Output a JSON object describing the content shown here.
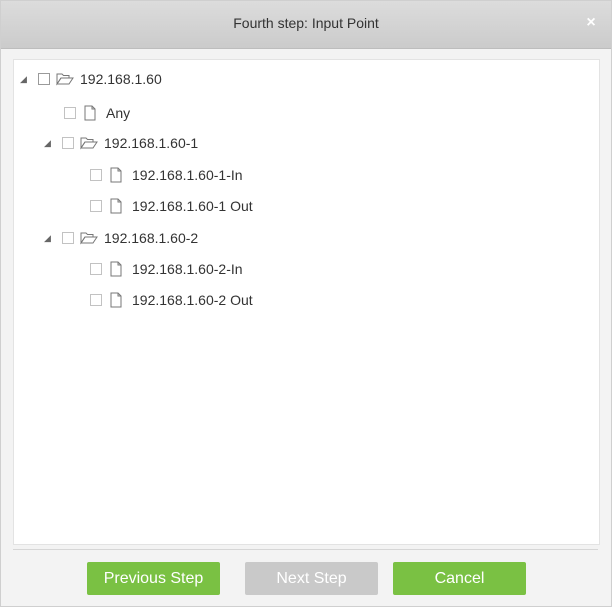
{
  "dialog": {
    "title": "Fourth step: Input Point",
    "close_glyph": "×"
  },
  "tree": {
    "nodes": [
      {
        "label": "192.168.1.60",
        "type": "folder",
        "expanded": true
      },
      {
        "label": "Any",
        "type": "file"
      },
      {
        "label": "192.168.1.60-1",
        "type": "folder",
        "expanded": true
      },
      {
        "label": "192.168.1.60-1-In",
        "type": "file"
      },
      {
        "label": "192.168.1.60-1 Out",
        "type": "file"
      },
      {
        "label": "192.168.1.60-2",
        "type": "folder",
        "expanded": true
      },
      {
        "label": "192.168.1.60-2-In",
        "type": "file"
      },
      {
        "label": "192.168.1.60-2 Out",
        "type": "file"
      }
    ]
  },
  "footer": {
    "previous_label": "Previous Step",
    "next_label": "Next Step",
    "cancel_label": "Cancel"
  },
  "colors": {
    "primary_button": "#7ac143",
    "disabled_button": "#c9c9c9",
    "titlebar": "#d3d3d3"
  },
  "icons": {
    "expand": "triangle-down-icon",
    "folder": "folder-open-icon",
    "file": "file-icon",
    "close": "close-icon"
  }
}
